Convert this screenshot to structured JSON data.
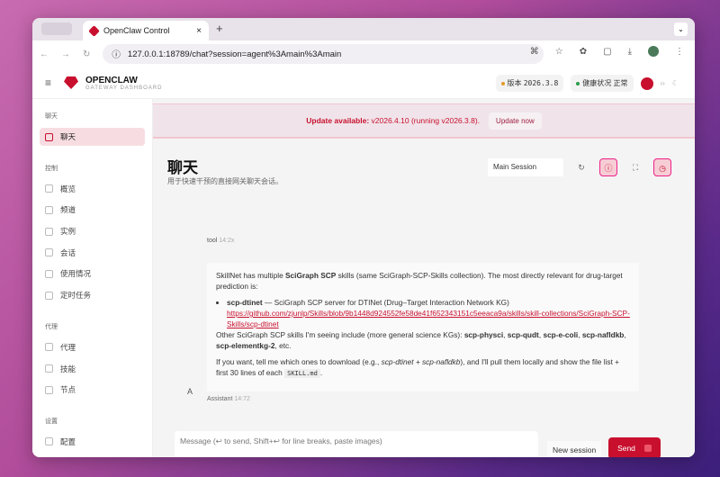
{
  "browser": {
    "tab_title": "OpenClaw Control",
    "url": "127.0.0.1:18789/chat?session=agent%3Amain%3Amain"
  },
  "header": {
    "brand": "OPENCLAW",
    "subtitle": "GATEWAY DASHBOARD",
    "version_label": "版本",
    "version": "2026.3.8",
    "health_label": "健康状况",
    "health": "正常"
  },
  "sidebar": {
    "sections": [
      {
        "title": "聊天",
        "items": [
          "聊天"
        ]
      },
      {
        "title": "控制",
        "items": [
          "概览",
          "频道",
          "实例",
          "会话",
          "使用情况",
          "定时任务"
        ]
      },
      {
        "title": "代理",
        "items": [
          "代理",
          "技能",
          "节点"
        ]
      },
      {
        "title": "设置",
        "items": [
          "配置"
        ]
      }
    ]
  },
  "banner": {
    "strong": "Update available:",
    "text": "v2026.4.10 (running v2026.3.8).",
    "button": "Update now"
  },
  "page": {
    "title": "聊天",
    "subtitle": "用于快速干预的直接网关聊天会话。",
    "session": "Main Session"
  },
  "messages": {
    "tool_label": "tool",
    "tool_time": "14:2x",
    "assistant_avatar": "A",
    "assistant_label": "Assistant",
    "assistant_time": "14:72",
    "p1a": "SkillNet has multiple ",
    "p1b": "SciGraph SCP",
    "p1c": " skills (same SciGraph-SCP-Skills collection). The most directly relevant for drug-target prediction is:",
    "li_b": "scp-dtinet",
    "li_t": " — SciGraph SCP server for DTINet (Drug–Target Interaction Network KG)",
    "link": "https://github.com/zjunlp/Skills/blob/9b1448d924552fe58de41f652343151c5eeaca9a/skills/skill-collections/SciGraph-SCP-Skills/scp-dtinet",
    "p2a": "Other SciGraph SCP skills I'm seeing include (more general science KGs): ",
    "k1": "scp-physci",
    "k2": "scp-qudt",
    "k3": "scp-e-coli",
    "k4": "scp-nafldkb",
    "k5": "scp-elementkg-2",
    "p2e": ", etc.",
    "p3a": "If you want, tell me which ones to download (e.g., ",
    "p3i": "scp-dtinet + scp-nafldkb",
    "p3b": "), and I'll pull them locally and show the file list + first 30 lines of each ",
    "p3code": "SKILL.md",
    "p3end": "."
  },
  "composer": {
    "placeholder": "Message (↩ to send, Shift+↩ for line breaks, paste images)",
    "new_session": "New session",
    "send": "Send"
  }
}
